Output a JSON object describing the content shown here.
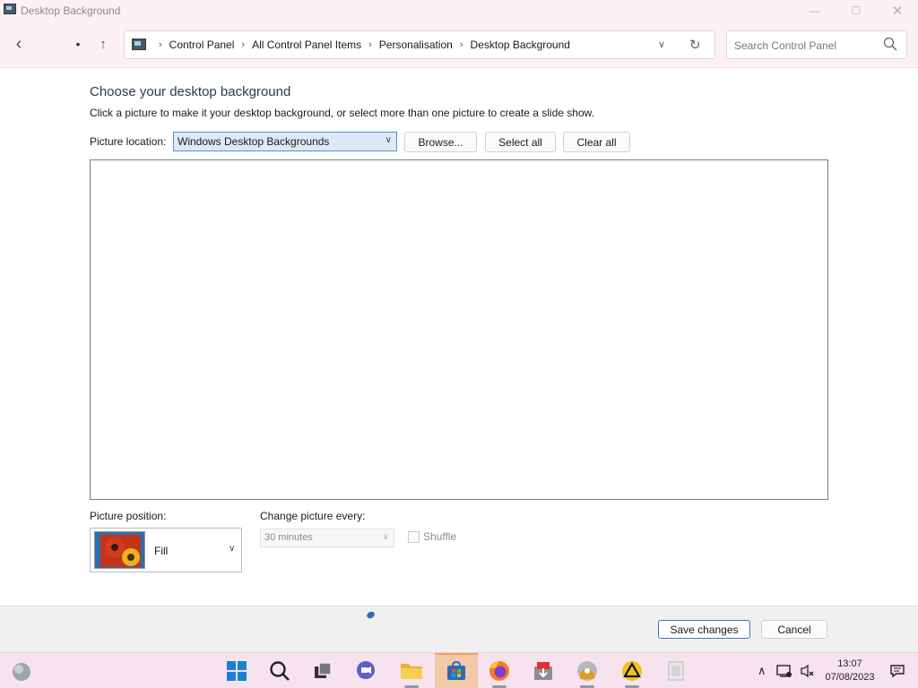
{
  "window": {
    "title": "Desktop Background",
    "controls": {
      "minimize": "—",
      "maximize": "☐",
      "close": "✕"
    }
  },
  "nav": {
    "breadcrumbs": [
      "Control Panel",
      "All Control Panel Items",
      "Personalisation",
      "Desktop Background"
    ],
    "search_placeholder": "Search Control Panel"
  },
  "main": {
    "heading": "Choose your desktop background",
    "subtext": "Click a picture to make it your desktop background, or select more than one picture to create a slide show.",
    "picture_location_label": "Picture location:",
    "picture_location_value": "Windows Desktop Backgrounds",
    "browse_label": "Browse...",
    "select_all_label": "Select all",
    "clear_all_label": "Clear all",
    "picture_position_label": "Picture position:",
    "picture_position_value": "Fill",
    "change_every_label": "Change picture every:",
    "change_every_value": "30 minutes",
    "shuffle_label": "Shuffle",
    "shuffle_checked": false
  },
  "footer": {
    "save_label": "Save changes",
    "cancel_label": "Cancel"
  },
  "taskbar": {
    "icons": [
      "weather-icon",
      "start-icon",
      "search-icon",
      "task-view-icon",
      "chat-icon",
      "file-explorer-icon",
      "store-icon",
      "firefox-icon",
      "app-installer-icon",
      "disc-app-icon",
      "warning-app-icon",
      "notepad-icon"
    ],
    "active_icon": "store-icon",
    "time": "13:07",
    "date": "07/08/2023"
  },
  "colors": {
    "titlebar_bg": "#fdf0f6",
    "taskbar_bg": "#f6e3ee",
    "accent": "#3b78c6",
    "selected_dropdown": "#dde9f7"
  }
}
